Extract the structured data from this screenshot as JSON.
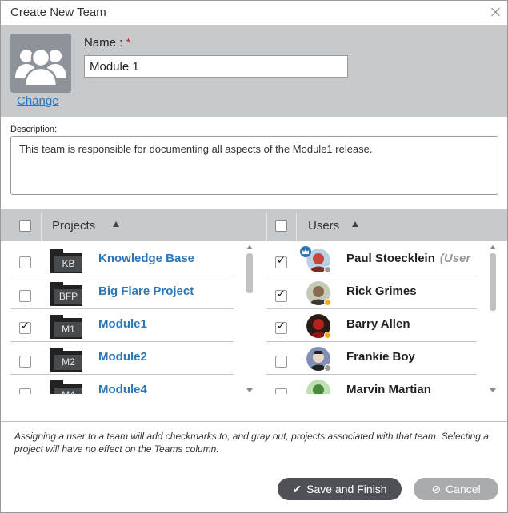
{
  "dialog": {
    "title": "Create New Team"
  },
  "header": {
    "change_link": "Change",
    "name_label": "Name :",
    "required_mark": "*",
    "name_value": "Module 1"
  },
  "description": {
    "label": "Description:",
    "value": "This team is responsible for documenting all aspects of the Module1 release."
  },
  "grid": {
    "projects_header": "Projects",
    "users_header": "Users",
    "projects": [
      {
        "abbr": "KB",
        "name": "Knowledge Base",
        "checked": false
      },
      {
        "abbr": "BFP",
        "name": "Big Flare Project",
        "checked": false
      },
      {
        "abbr": "M1",
        "name": "Module1",
        "checked": true
      },
      {
        "abbr": "M2",
        "name": "Module2",
        "checked": false
      },
      {
        "abbr": "M4",
        "name": "Module4",
        "checked": false
      }
    ],
    "users": [
      {
        "name": "Paul Stoecklein",
        "role": "(User",
        "checked": true,
        "status_color": "#9a9a9a",
        "admin": true
      },
      {
        "name": "Rick Grimes",
        "checked": true,
        "status_color": "#f5a623",
        "admin": false
      },
      {
        "name": "Barry Allen",
        "checked": true,
        "status_color": "#f5a623",
        "admin": false
      },
      {
        "name": "Frankie Boy",
        "checked": false,
        "status_color": "#9a9a9a",
        "admin": false
      },
      {
        "name": "Marvin Martian",
        "checked": false,
        "status_color": "#9a9a9a",
        "admin": false
      }
    ]
  },
  "footer": {
    "note": "Assigning a user to a team will add checkmarks to, and gray out, projects associated with that team. Selecting a project will have no effect on the Teams column.",
    "save_label": "Save and Finish",
    "cancel_label": "Cancel"
  },
  "colors": {
    "link_blue": "#2a77b9",
    "header_gray": "#c6cacd",
    "save_button": "#4e5256",
    "cancel_button": "#a9acaf",
    "required_red": "#c0282d"
  }
}
